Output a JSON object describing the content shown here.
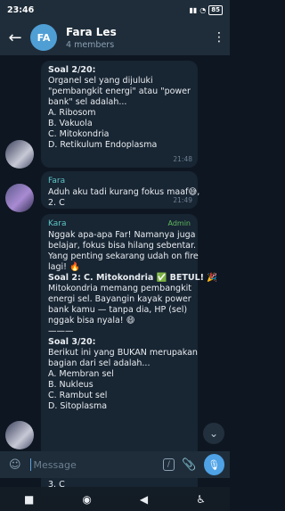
{
  "status": {
    "time": "23:46",
    "battery": "85"
  },
  "header": {
    "avatar_initials": "FA",
    "title": "Fara Les",
    "subtitle": "4 members"
  },
  "messages": [
    {
      "sender": "",
      "lines": [
        "Soal 2/20:",
        "Organel sel yang dijuluki",
        "\"pembangkit energi\" atau \"power",
        "bank\" sel adalah...",
        "",
        "A. Ribosom",
        "B. Vakuola",
        "C. Mitokondria",
        "D. Retikulum Endoplasma"
      ],
      "time": "21:48"
    },
    {
      "sender": "Fara",
      "lines": [
        "Aduh aku tadi kurang fokus maaf😅,",
        "2. C"
      ],
      "time": "21:49"
    },
    {
      "sender": "Kara",
      "badge": "Admin",
      "lines": [
        "Nggak apa-apa Far! Namanya juga",
        "belajar, fokus bisa hilang sebentar.",
        "Yang penting sekarang udah on fire",
        "lagi! 🔥",
        "",
        "Soal 2: C. Mitokondria ✅ BETUL! 🎉",
        "",
        "Mitokondria memang pembangkit",
        "energi sel. Bayangin kayak power",
        "bank kamu — tanpa dia, HP (sel)",
        "nggak bisa nyala! 😄",
        "",
        "———",
        "Soal 3/20:",
        "Berikut ini yang BUKAN merupakan",
        "bagian dari sel adalah...",
        "",
        "A. Membran sel",
        "B. Nukleus",
        "C. Rambut sel",
        "D. Sitoplasma"
      ]
    }
  ],
  "behind_input": "3. C",
  "input": {
    "placeholder": "Message"
  },
  "icons": {
    "back": "back-arrow-icon",
    "menu": "more-vert-icon",
    "emoji": "emoji-icon",
    "command": "command-icon",
    "attach": "attach-icon",
    "mic": "mic-icon",
    "scroll": "scroll-down-icon"
  },
  "colors": {
    "accent": "#4ea2e5",
    "admin": "#5fba5f",
    "sender": "#5ec6c9",
    "bubble": "#182533",
    "background": "#0e1621"
  }
}
